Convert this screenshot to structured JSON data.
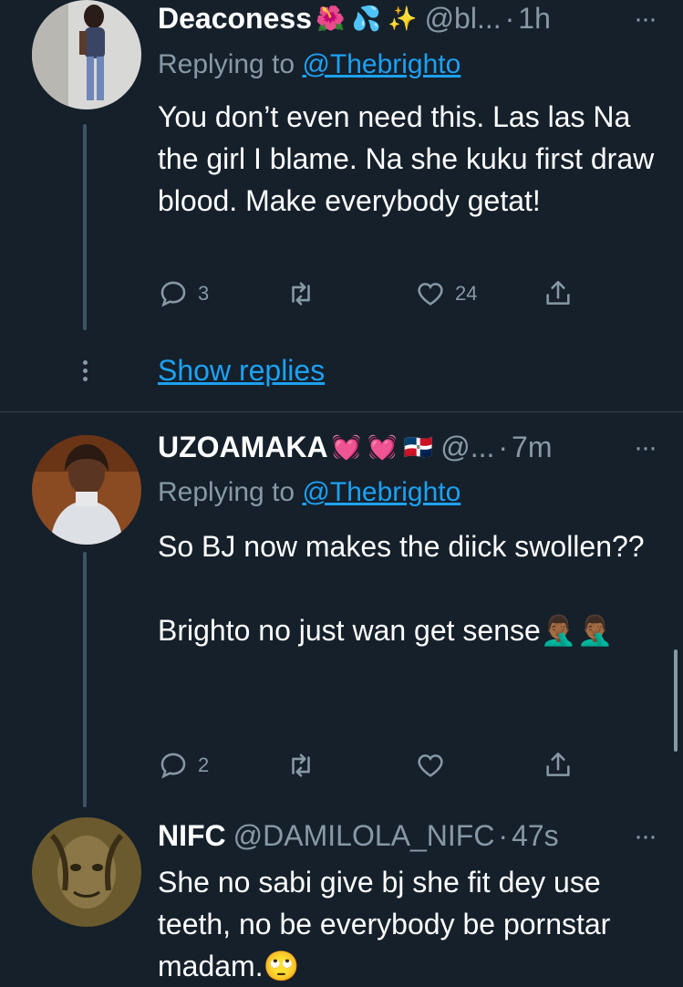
{
  "tweets": [
    {
      "name": "Deaconess",
      "name_emojis": "🌺 💦 ✨",
      "handle": "@bl...",
      "time": "1h",
      "reply_label": "Replying to",
      "reply_handle": "@Thebrighto",
      "text": "You don’t even need this. Las las Na the girl I blame. Na she kuku first draw blood. Make everybody getat!",
      "replies": "3",
      "retweets": "",
      "likes": "24"
    },
    {
      "name": "UZOAMAKA",
      "name_emojis": "💓 💓 🇩🇴",
      "handle": "@...",
      "time": "7m",
      "reply_label": "Replying to",
      "reply_handle": "@Thebrighto",
      "text_line1": "So BJ now makes the diick swollen??",
      "text_line2": "Brighto no just wan get sense🤦🏾‍♂️🤦🏾‍♂️",
      "replies": "2",
      "retweets": "",
      "likes": ""
    },
    {
      "name": "NIFC",
      "handle": "@DAMILOLA_NIFC",
      "time": "47s",
      "text": "She no sabi give bj she fit dey use teeth, no be everybody be pornstar madam.🙄"
    }
  ],
  "show_replies": "Show replies",
  "more_glyph": "···",
  "dot": "·",
  "icons": {
    "reply": "reply-icon",
    "retweet": "retweet-icon",
    "like": "heart-icon",
    "share": "share-icon",
    "more": "more-icon"
  },
  "colors": {
    "background": "#15202b",
    "link": "#1da1f2",
    "secondary_text": "#8899a6",
    "divider": "#38444d"
  }
}
